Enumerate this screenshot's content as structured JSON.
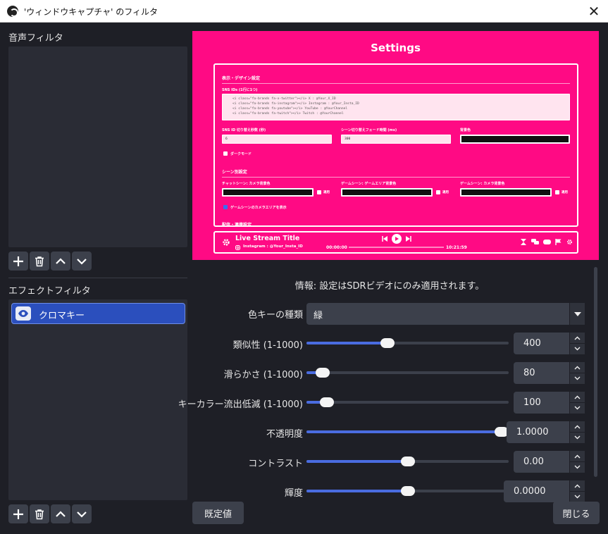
{
  "window": {
    "title": "'ウィンドウキャプチャ' のフィルタ",
    "close_glyph": "✕"
  },
  "audio_filters": {
    "label": "音声フィルタ"
  },
  "effect_filters": {
    "label": "エフェクトフィルタ",
    "items": [
      {
        "name": "クロマキー",
        "visible": true,
        "selected": true
      }
    ]
  },
  "toolbar_icons": [
    "plus-icon",
    "trash-icon",
    "chevron-up-icon",
    "chevron-down-icon"
  ],
  "preview": {
    "background_color": "#ff0a84",
    "title": "Settings",
    "section1_title": "表示・デザイン設定",
    "sns_ids_label": "SNS IDs (1行に1つ)",
    "sns_code_lines": [
      "<i class=\"fa-brands fa-x-twitter\"></i> X : @Your_X_ID",
      "<i class=\"fa-brands fa-instagram\"></i> Instagram : @Your_Insta_ID",
      "<i class=\"fa-brands fa-youtube\"></i> YouTube : @YourChannel",
      "<i class=\"fa-brands fa-twitch\"></i> Twitch : @YourChannel"
    ],
    "sns_interval_label": "SNS ID 切り替え秒数 (秒)",
    "sns_interval_value": "6",
    "fade_label": "シーン切り替えフェード時間 (ms)",
    "fade_value": "300",
    "bg_color_label": "背景色",
    "dark_mode_label": "ダークモード",
    "section2_title": "シーン別設定",
    "chat_scene_label": "チャットシーン: カメラ背景色",
    "game_scene_label": "ゲームシーン: ゲームエリア背景色",
    "game_camera_label": "ゲームシーン: カメラ背景色",
    "apply_label": "適用",
    "show_camera_area_label": "ゲームシーンのカメラエリアを表示",
    "section3_title": "配信・連携設定",
    "bar_title": "Live Stream Title",
    "bar_social": "Instagram : @Your_Insta_ID",
    "time_elapsed": "00:00:00",
    "time_total": "10:21:59"
  },
  "properties": {
    "info": "情報: 設定はSDRビデオにのみ適用されます。",
    "key_color_type": {
      "label": "色キーの種類",
      "value": "緑"
    },
    "sliders": [
      {
        "label": "類似性 (1-1000)",
        "value": "400",
        "fraction": 0.4
      },
      {
        "label": "滑らかさ (1-1000)",
        "value": "80",
        "fraction": 0.08
      },
      {
        "label": "キーカラー流出低減 (1-1000)",
        "value": "100",
        "fraction": 0.1
      },
      {
        "label": "不透明度",
        "value": "1.0000",
        "fraction": 1.0
      },
      {
        "label": "コントラスト",
        "value": "0.00",
        "fraction": 0.5
      },
      {
        "label": "輝度",
        "value": "0.0000",
        "fraction": 0.5
      }
    ]
  },
  "buttons": {
    "defaults": "既定値",
    "close": "閉じる"
  }
}
